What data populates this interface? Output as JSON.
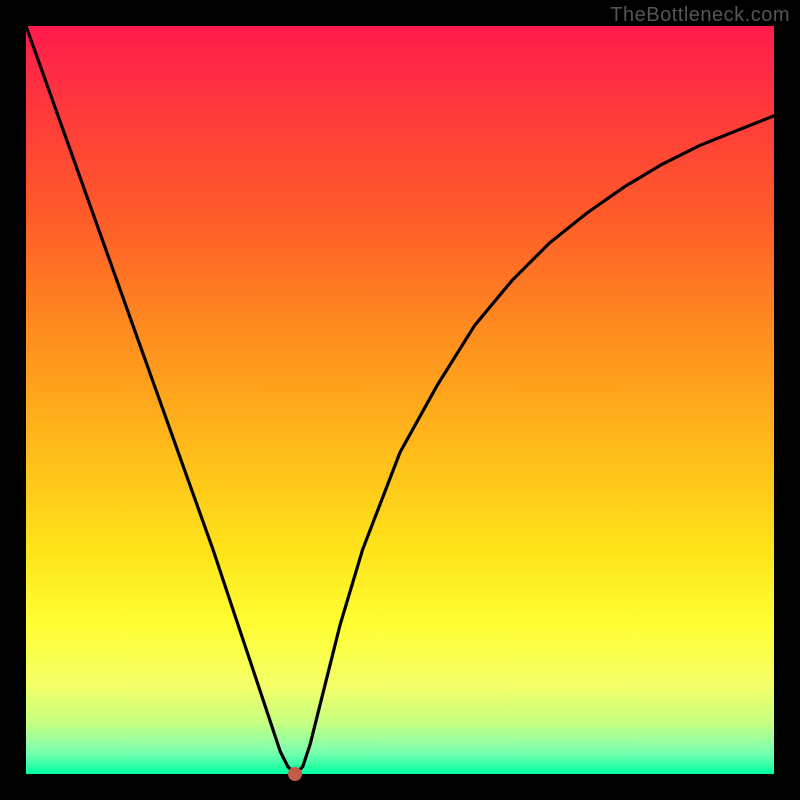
{
  "watermark": "TheBottleneck.com",
  "chart_data": {
    "type": "line",
    "title": "",
    "xlabel": "",
    "ylabel": "",
    "xlim": [
      0,
      100
    ],
    "ylim": [
      0,
      100
    ],
    "series": [
      {
        "name": "curve",
        "x": [
          0,
          5,
          10,
          15,
          20,
          25,
          28,
          30,
          32,
          33,
          34,
          35,
          36,
          37,
          38,
          40,
          42,
          45,
          50,
          55,
          60,
          65,
          70,
          75,
          80,
          85,
          90,
          95,
          100
        ],
        "values": [
          100,
          86,
          72,
          58,
          44,
          30,
          21,
          15,
          9,
          6,
          3,
          1,
          0,
          1,
          4,
          12,
          20,
          30,
          43,
          52,
          60,
          66,
          71,
          75,
          78.5,
          81.5,
          84,
          86,
          88
        ]
      }
    ],
    "marker": {
      "x": 36,
      "y": 0,
      "color": "#c45a4a"
    }
  },
  "background_gradient": {
    "top": "#ff1a4d",
    "mid": "#ffe31a",
    "bottom": "#00ffa0"
  }
}
